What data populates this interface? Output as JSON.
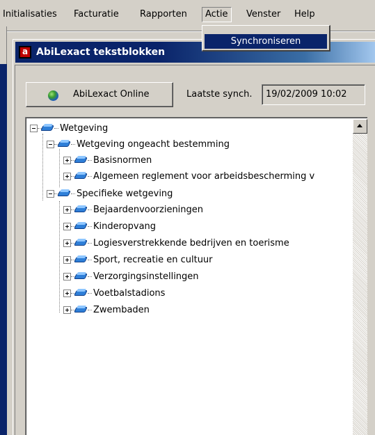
{
  "menu": {
    "items": [
      "Initialisaties",
      "Facturatie",
      "Rapporten",
      "Actie",
      "Venster",
      "Help"
    ],
    "open_menu": "Actie",
    "dropdown_items": [
      "Synchroniseren"
    ]
  },
  "window": {
    "title": "AbiLexact tekstblokken",
    "online_button": "AbiLexact Online",
    "last_sync_label": "Laatste synch.",
    "last_sync_value": "19/02/2009 10:02"
  },
  "tree": {
    "root": {
      "label": "Wetgeving",
      "expanded": true,
      "children": [
        {
          "label": "Wetgeving ongeacht bestemming",
          "expanded": true,
          "children": [
            {
              "label": "Basisnormen",
              "expanded": false
            },
            {
              "label": "Algemeen reglement voor arbeidsbescherming v",
              "expanded": false
            }
          ]
        },
        {
          "label": "Specifieke wetgeving",
          "expanded": true,
          "children": [
            {
              "label": "Bejaardenvoorzieningen",
              "expanded": false
            },
            {
              "label": "Kinderopvang",
              "expanded": false
            },
            {
              "label": "Logiesverstrekkende bedrijven en toerisme",
              "expanded": false
            },
            {
              "label": "Sport, recreatie en cultuur",
              "expanded": false
            },
            {
              "label": "Verzorgingsinstellingen",
              "expanded": false
            },
            {
              "label": "Voetbalstadions",
              "expanded": false
            },
            {
              "label": "Zwembaden",
              "expanded": false
            }
          ]
        }
      ]
    }
  },
  "colors": {
    "menu_highlight": "#0a246a",
    "title_active": "#0a246a",
    "face": "#d4d0c8"
  }
}
